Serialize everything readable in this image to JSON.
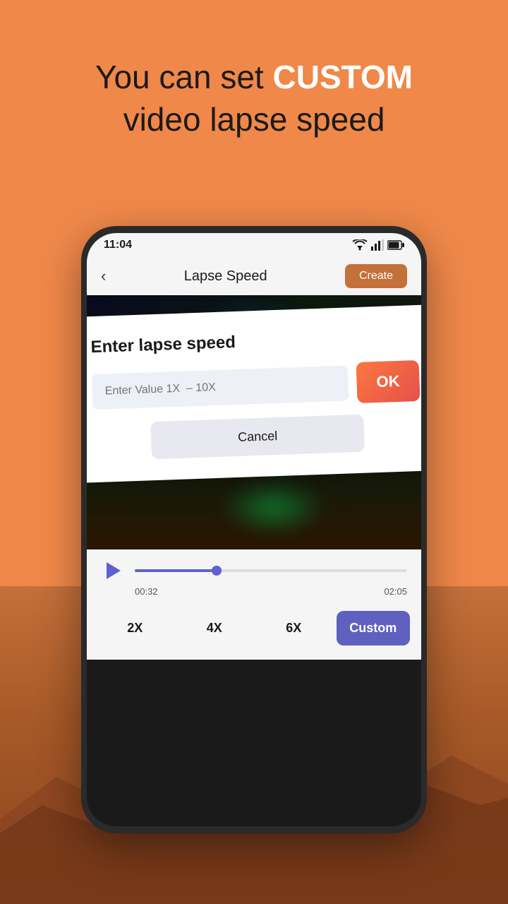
{
  "page": {
    "background_color": "#F0884A"
  },
  "header": {
    "line1_prefix": "You can set ",
    "line1_highlight": "CUSTOM",
    "line2": "video lapse speed"
  },
  "status_bar": {
    "time": "11:04"
  },
  "nav": {
    "back_icon": "‹",
    "title": "Lapse Speed",
    "create_button": "Create"
  },
  "dialog": {
    "title": "Enter lapse speed",
    "input_placeholder": "Enter Value 1X  – 10X",
    "ok_button": "OK",
    "cancel_button": "Cancel"
  },
  "player": {
    "time_current": "00:32",
    "time_total": "02:05",
    "progress_percent": 30
  },
  "speed_buttons": [
    {
      "label": "2X",
      "active": false
    },
    {
      "label": "4X",
      "active": false
    },
    {
      "label": "6X",
      "active": false
    },
    {
      "label": "Custom",
      "active": true
    }
  ]
}
